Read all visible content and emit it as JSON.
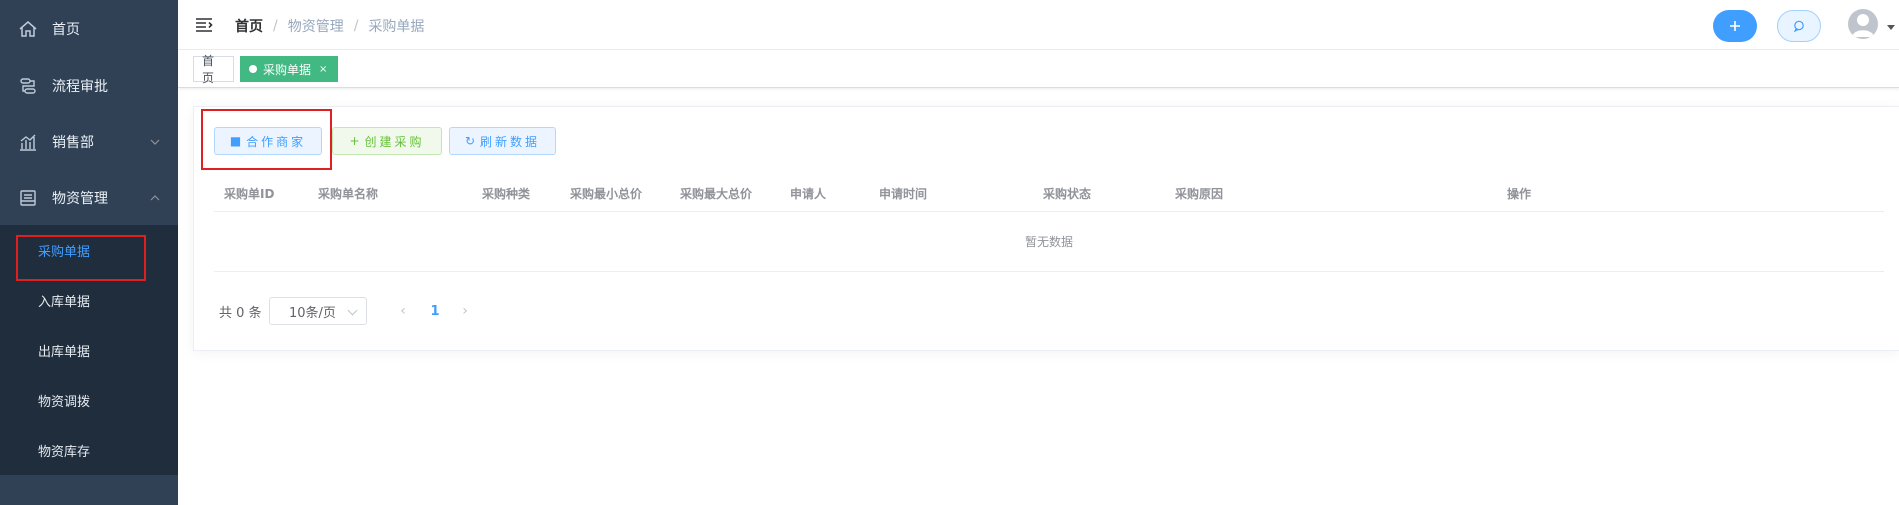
{
  "sidebar": {
    "items": [
      {
        "label": "首页",
        "icon": "home-icon"
      },
      {
        "label": "流程审批",
        "icon": "flow-icon"
      },
      {
        "label": "销售部",
        "icon": "chart-icon",
        "arrow": "chevron-down-icon"
      },
      {
        "label": "物资管理",
        "icon": "document-icon",
        "arrow": "chevron-up-icon"
      }
    ],
    "submenu": [
      {
        "label": "采购单据",
        "active": true
      },
      {
        "label": "入库单据"
      },
      {
        "label": "出库单据"
      },
      {
        "label": "物资调拨"
      },
      {
        "label": "物资库存"
      }
    ],
    "colors": {
      "bg": "#304156",
      "submenu_bg": "#1f2d3d",
      "active_text": "#409eff"
    }
  },
  "navbar": {
    "breadcrumb": {
      "home": "首页",
      "sep": "/",
      "level1": "物资管理",
      "level2": "采购单据"
    },
    "plus_icon": "plus-icon",
    "chat_icon": "chat-icon",
    "avatar_icon": "user-avatar-icon"
  },
  "tags": {
    "home": "首页",
    "active": "采购单据",
    "close": "×"
  },
  "toolbar": {
    "partner_label": "合作商家",
    "partner_icon": "■",
    "create_label": "创建采购",
    "create_icon": "+",
    "refresh_label": "刷新数据",
    "refresh_icon": "↻"
  },
  "table": {
    "columns": [
      "采购单ID",
      "采购单名称",
      "采购种类",
      "采购最小总价",
      "采购最大总价",
      "申请人",
      "申请时间",
      "采购状态",
      "采购原因",
      "操作"
    ],
    "rows": [],
    "empty_text": "暂无数据"
  },
  "pagination": {
    "total_text": "共 0 条",
    "page_size": "10条/页",
    "prev": "‹",
    "current_page": "1",
    "next": "›"
  }
}
